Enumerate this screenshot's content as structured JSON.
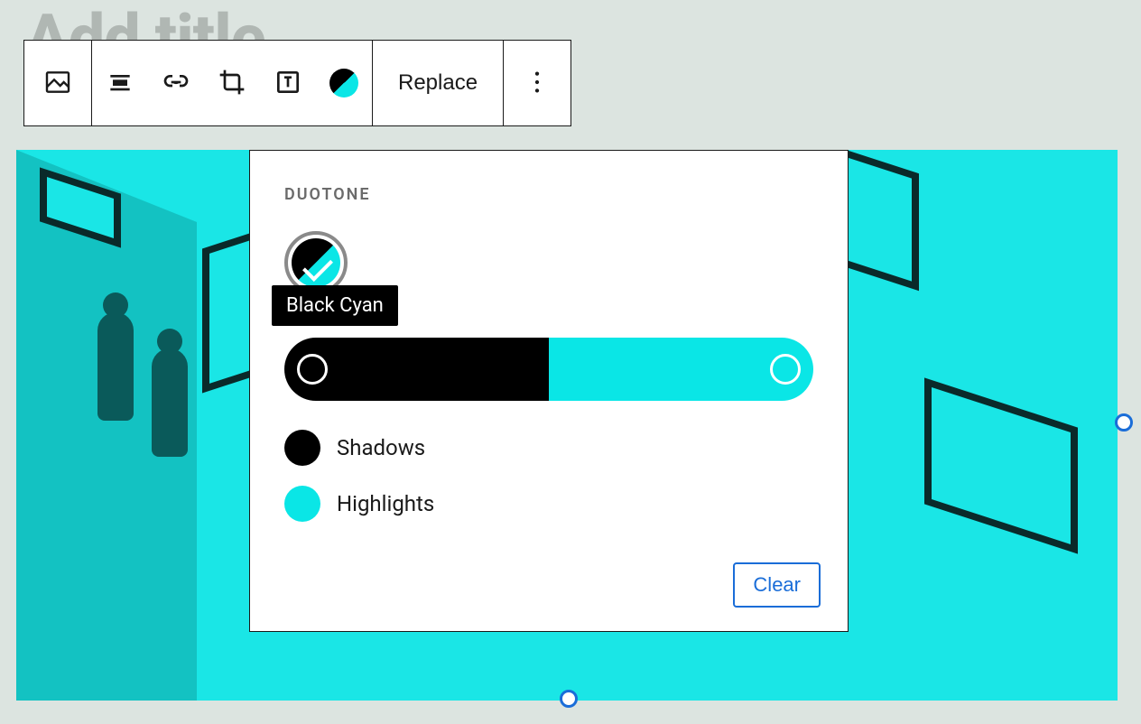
{
  "editor": {
    "title_placeholder": "Add title"
  },
  "toolbar": {
    "replace_label": "Replace"
  },
  "duotone": {
    "panel_title": "Duotone",
    "selected_preset": "Black Cyan",
    "shadows_label": "Shadows",
    "shadows_color": "#000000",
    "highlights_label": "Highlights",
    "highlights_color": "#0ae6e6",
    "clear_label": "Clear"
  }
}
